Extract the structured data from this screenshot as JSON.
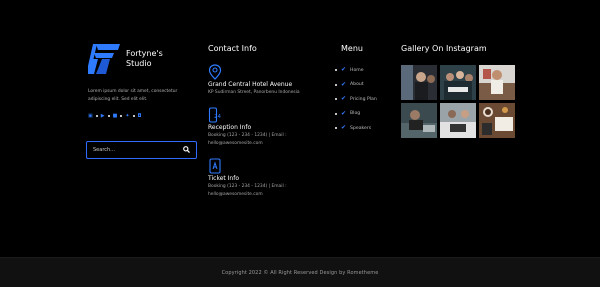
{
  "brand": {
    "name": "Fortyne's Studio",
    "about": "Lorem ipsum dolor sit amet, consectetur adipiscing elit. Sed elit elit.",
    "socials": [
      "facebook-icon",
      "youtube-icon",
      "linkedin-icon",
      "twitter-icon",
      "instagram-icon"
    ],
    "accent": "#2f7bff"
  },
  "search": {
    "placeholder": "Search..."
  },
  "contact": {
    "title": "Contact Info",
    "items": [
      {
        "icon": "location-pin-icon",
        "title": "Grand Central Hotel Avenue",
        "text": "KP Sudirman Street, Panorbenu Indonesia"
      },
      {
        "icon": "phone-24-icon",
        "title": "Reception Info",
        "text": "Booking (123 - 234 - 1234) | Email :",
        "email": "hello@awesomesite.com"
      },
      {
        "icon": "ticket-icon",
        "title": "Ticket Info",
        "text": "Booking (123 - 234 - 1234) | Email :",
        "email": "hello@awesomesite.com"
      }
    ]
  },
  "menu": {
    "title": "Menu",
    "items": [
      "Home",
      "About",
      "Pricing Plan",
      "Blog",
      "Speakers"
    ]
  },
  "gallery": {
    "title": "Gallery On Instagram"
  },
  "footer": {
    "copyright": "Copyright 2022 © All Right Reserved Design by Rometheme"
  }
}
